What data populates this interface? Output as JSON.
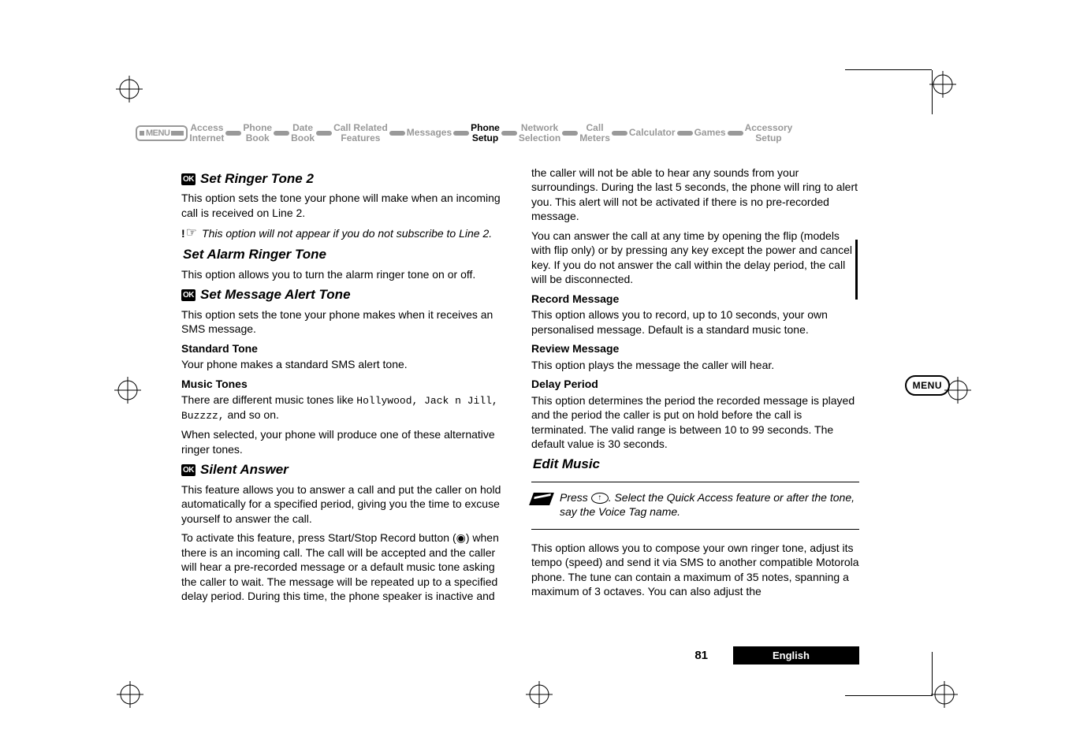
{
  "breadcrumb": {
    "menu": "MENU",
    "items": [
      {
        "l1": "Access",
        "l2": "Internet"
      },
      {
        "l1": "Phone",
        "l2": "Book"
      },
      {
        "l1": "Date",
        "l2": "Book"
      },
      {
        "l1": "Call Related",
        "l2": "Features"
      },
      {
        "l1": "Messages",
        "l2": ""
      },
      {
        "l1": "Phone",
        "l2": "Setup"
      },
      {
        "l1": "Network",
        "l2": "Selection"
      },
      {
        "l1": "Call",
        "l2": "Meters"
      },
      {
        "l1": "Calculator",
        "l2": ""
      },
      {
        "l1": "Games",
        "l2": ""
      },
      {
        "l1": "Accessory",
        "l2": "Setup"
      }
    ]
  },
  "left": {
    "h_setringer2": "Set Ringer Tone 2",
    "p_setringer2": "This option sets the tone your phone will make when an incoming call is received on Line 2.",
    "note_setringer2": "This option will not appear if you do not subscribe to Line 2.",
    "h_alarm": "Set Alarm Ringer Tone",
    "p_alarm": "This option allows you to turn the alarm ringer tone on or off.",
    "h_msg": "Set Message Alert Tone",
    "p_msg": "This option sets the tone your phone makes when it receives an SMS message.",
    "h_std": "Standard Tone",
    "p_std": "Your phone makes a standard SMS alert tone.",
    "h_music": "Music Tones",
    "p_music_a": "There are different music tones like ",
    "p_music_mono": "Hollywood, Jack n Jill, Buzzzz,",
    "p_music_b": " and so on.",
    "p_music2": "When selected, your phone will produce one of these alternative ringer tones.",
    "h_silent": "Silent Answer",
    "p_silent1": "This feature allows you to answer a call and put the caller on hold automatically for a specified period, giving you the time to excuse yourself to answer the call.",
    "p_silent2": "To activate this feature, press Start/Stop Record button (◉) when there is an incoming call. The call will be accepted and the caller will hear a pre-recorded message or a default music tone asking the caller to wait. The message will be repeated up to a specified delay period. During this time, the phone speaker is inactive and"
  },
  "right": {
    "p_cont": "the caller will not be able to hear any sounds from your surroundings. During the last 5 seconds, the phone will ring to alert you. This alert will not be activated if there is no pre-recorded message.",
    "p_answer": "You can answer the call at any time by opening the flip (models with flip only) or by pressing any key except the power and cancel key. If you do not answer the call within the delay period, the call will be disconnected.",
    "h_record": "Record Message",
    "p_record": "This option allows you to record, up to 10 seconds, your own personalised message. Default is a standard music tone.",
    "h_review": "Review Message",
    "p_review": "This option plays the message the caller will hear.",
    "h_delay": "Delay Period",
    "p_delay": "This option determines the period the recorded message is played and the period the caller is put on hold before the call is terminated. The valid range is between 10 to 99 seconds. The default value is 30 seconds.",
    "h_edit": "Edit Music",
    "tip_a": "Press ",
    "tip_key": "↑",
    "tip_b": ". Select the Quick Access feature or after the tone, say the Voice Tag name.",
    "p_edit": "This option allows you to compose your own ringer tone, adjust its tempo (speed) and send it via SMS to another compatible Motorola phone. The tune can contain a maximum of 35 notes, spanning a maximum of 3 octaves. You can also adjust the"
  },
  "side_menu": "MENU",
  "ok_label": "OK",
  "footer": {
    "page": "81",
    "lang": "English"
  }
}
